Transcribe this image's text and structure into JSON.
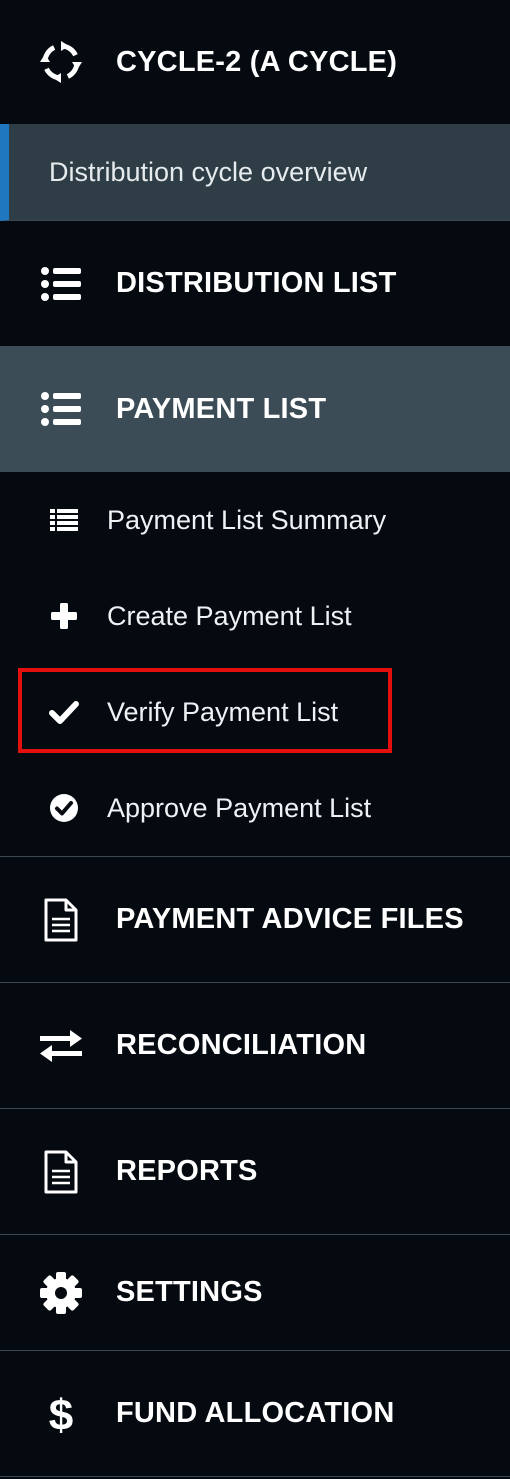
{
  "header": {
    "cycle_title": "CYCLE-2 (A CYCLE)",
    "cycle_icon": "cycle-arrows-icon"
  },
  "nav": {
    "overview_label": "Distribution cycle overview",
    "distribution_list": {
      "label": "DISTRIBUTION LIST",
      "icon": "list-icon"
    },
    "payment_list": {
      "label": "PAYMENT LIST",
      "icon": "list-icon",
      "sub_items": [
        {
          "label": "Payment List Summary",
          "icon": "list-alt-icon"
        },
        {
          "label": "Create Payment List",
          "icon": "plus-icon"
        },
        {
          "label": "Verify Payment List",
          "icon": "check-icon",
          "highlighted": true
        },
        {
          "label": "Approve Payment List",
          "icon": "check-circle-icon"
        }
      ]
    },
    "payment_advice_files": {
      "label": "PAYMENT ADVICE FILES",
      "icon": "document-icon"
    },
    "reconciliation": {
      "label": "RECONCILIATION",
      "icon": "exchange-icon"
    },
    "reports": {
      "label": "REPORTS",
      "icon": "document-icon"
    },
    "settings": {
      "label": "SETTINGS",
      "icon": "gear-icon"
    },
    "fund_allocation": {
      "label": "FUND ALLOCATION",
      "icon": "dollar-icon"
    }
  },
  "colors": {
    "background": "#050a10",
    "active_background": "#3b4c56",
    "overview_background": "#2f3d46",
    "accent_blue": "#1f77c0",
    "highlight_red": "#e3100f"
  }
}
